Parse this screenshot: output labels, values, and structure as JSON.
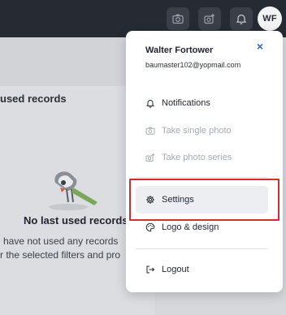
{
  "header": {
    "avatar_initials": "WF",
    "icons": [
      "camera-icon",
      "camera-series-icon",
      "bell-icon"
    ]
  },
  "background": {
    "section_title": "used records",
    "empty_title": "No last used records",
    "empty_line1": "have not used any records",
    "empty_line2": "r the selected filters and pro"
  },
  "menu": {
    "user_name": "Walter Fortower",
    "user_email": "baumaster102@yopmail.com",
    "close_label": "×",
    "items": [
      {
        "label": "Notifications",
        "icon": "bell-icon",
        "enabled": true
      },
      {
        "label": "Take single photo",
        "icon": "camera-icon",
        "enabled": false
      },
      {
        "label": "Take photo series",
        "icon": "camera-series-icon",
        "enabled": false
      },
      {
        "label": "Settings",
        "icon": "gear-icon",
        "enabled": true,
        "active": true
      },
      {
        "label": "Logo & design",
        "icon": "palette-icon",
        "enabled": true
      },
      {
        "label": "Logout",
        "icon": "logout-icon",
        "enabled": true
      }
    ]
  },
  "colors": {
    "topbar": "#262b33",
    "accent": "#3566c9",
    "highlight": "#cf2e2e",
    "disabled_text": "#a6aab2"
  }
}
